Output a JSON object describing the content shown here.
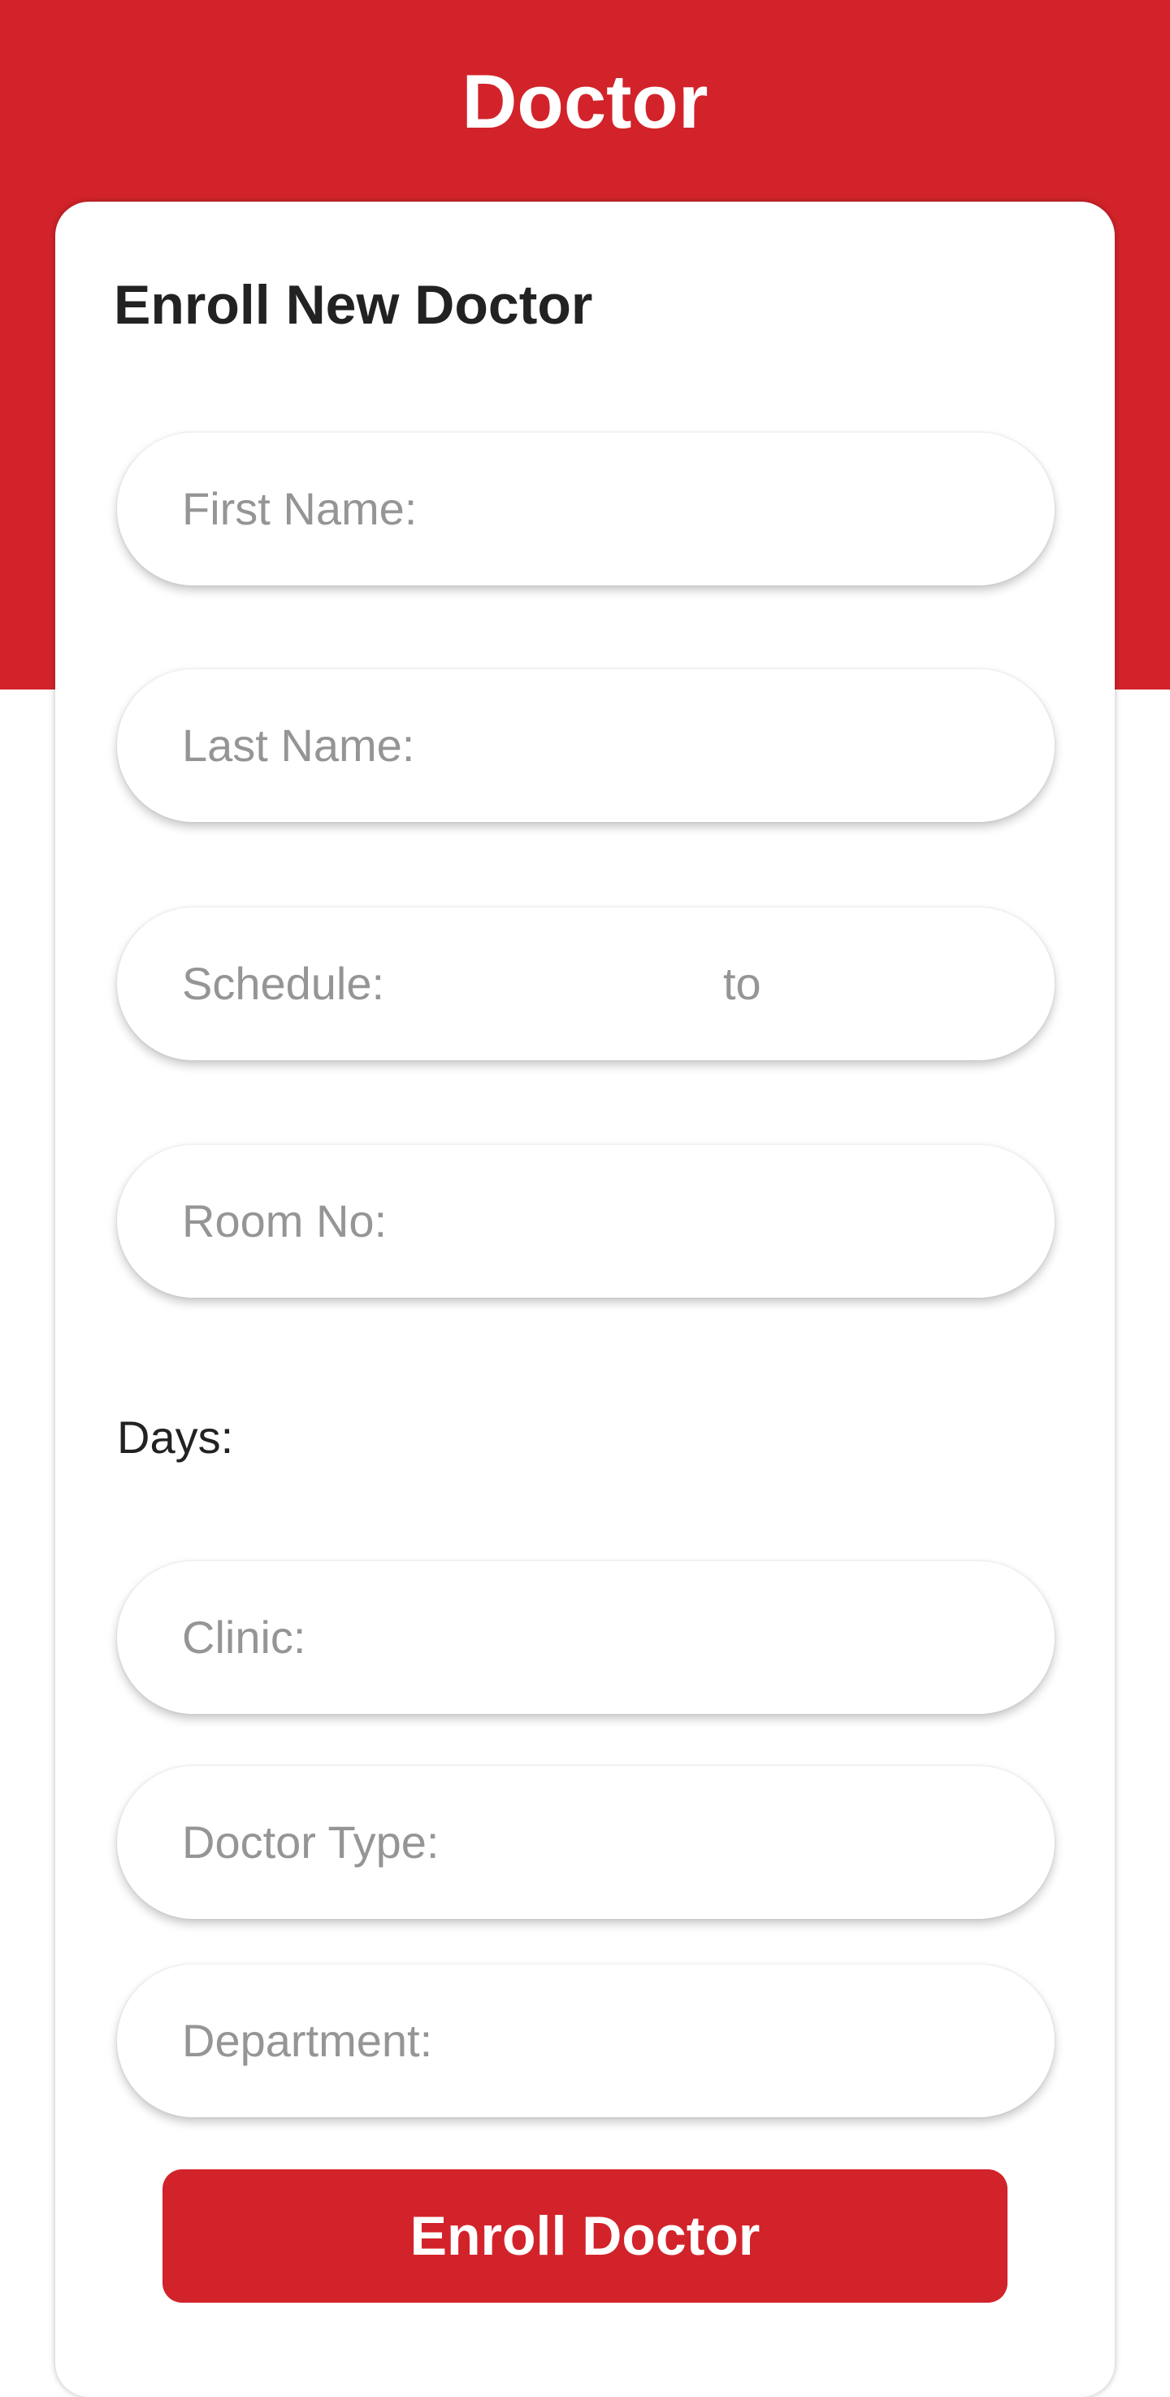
{
  "app": {
    "title": "Doctor"
  },
  "form": {
    "title": "Enroll New Doctor",
    "first_name_label": "First Name:",
    "last_name_label": "Last Name:",
    "schedule_label": "Schedule:",
    "schedule_to_label": "to",
    "room_no_label": "Room No:",
    "days_label": "Days:",
    "clinic_label": "Clinic:",
    "doctor_type_label": "Doctor Type:",
    "department_label": "Department:",
    "submit_label": "Enroll Doctor"
  },
  "colors": {
    "brand_red": "#d2232a",
    "placeholder_gray": "#959595",
    "text_dark": "#222222",
    "background": "#ffffff"
  }
}
